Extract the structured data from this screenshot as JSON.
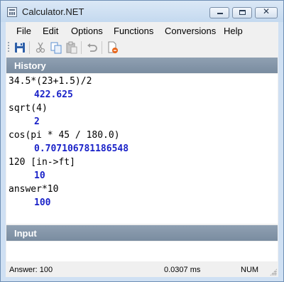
{
  "window": {
    "title": "Calculator.NET",
    "controls": {
      "minimize": "",
      "maximize": "",
      "close": "✕"
    }
  },
  "menu": [
    "File",
    "Edit",
    "Options",
    "Functions",
    "Conversions",
    "Help"
  ],
  "toolbar": {
    "icons": [
      "save-icon",
      "cut-icon",
      "copy-icon",
      "paste-icon",
      "undo-icon",
      "clear-history-icon"
    ]
  },
  "history": {
    "header": "History",
    "entries": [
      {
        "expression": "34.5*(23+1.5)/2",
        "result": "422.625"
      },
      {
        "expression": "sqrt(4)",
        "result": "2"
      },
      {
        "expression": "cos(pi * 45 / 180.0)",
        "result": "0.707106781186548"
      },
      {
        "expression": "120 [in->ft]",
        "result": "10"
      },
      {
        "expression": "answer*10",
        "result": "100"
      }
    ]
  },
  "input": {
    "header": "Input",
    "value": ""
  },
  "status": {
    "answer": "Answer: 100",
    "time": "0.0307 ms",
    "num": "NUM"
  },
  "colors": {
    "panel_header": "#8596a9",
    "result_text": "#1a22c8",
    "frame": "#cfe0f3"
  }
}
